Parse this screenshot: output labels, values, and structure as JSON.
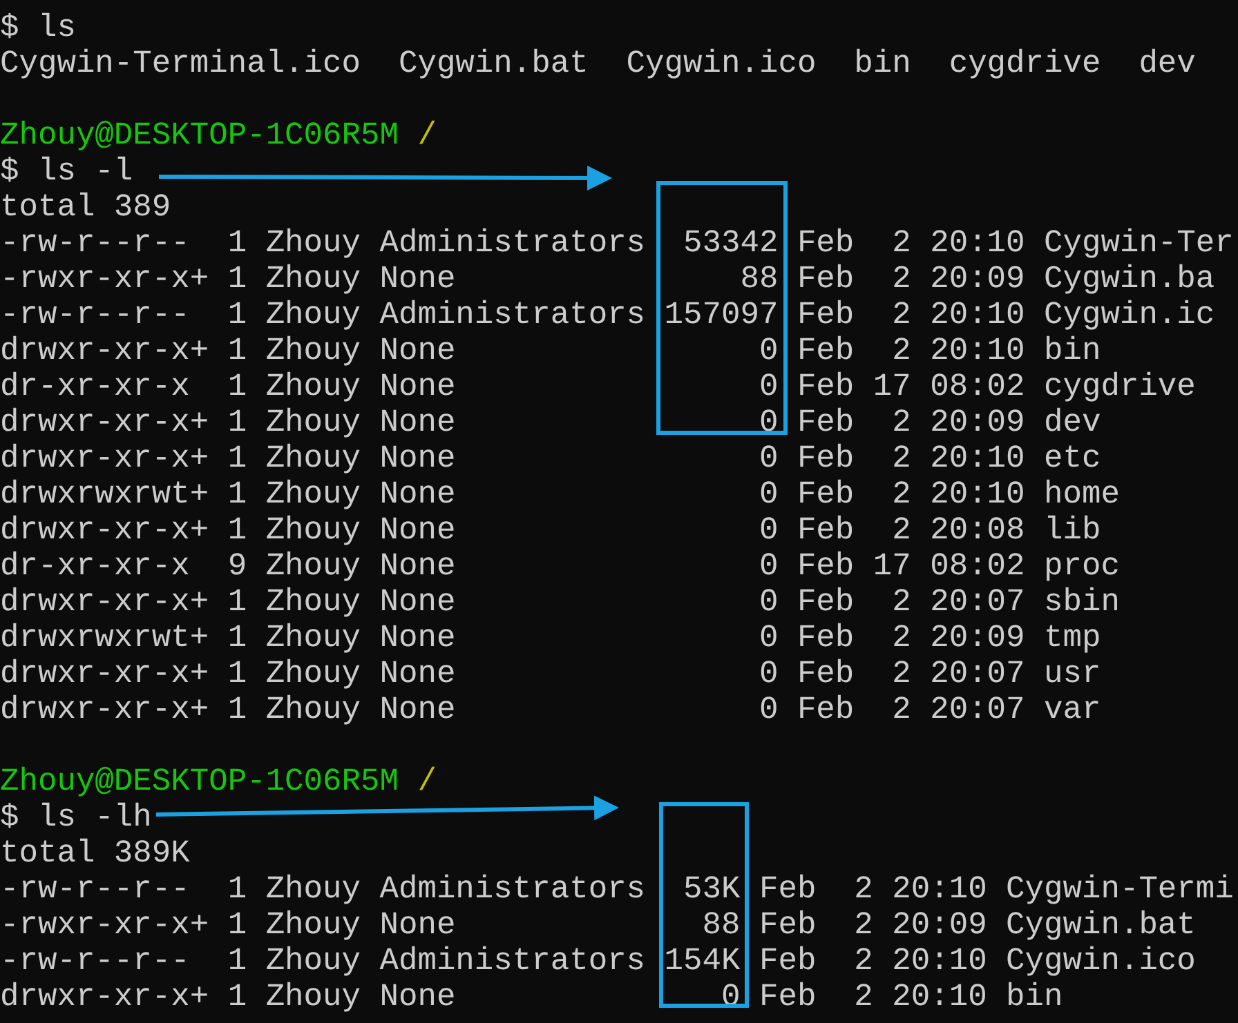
{
  "terminal": {
    "lines": [
      {
        "kind": "command",
        "text": "$ ls"
      },
      {
        "kind": "output",
        "text": "Cygwin-Terminal.ico  Cygwin.bat  Cygwin.ico  bin  cygdrive  dev"
      },
      {
        "kind": "blank"
      },
      {
        "kind": "prompt",
        "user_host": "Zhouy@DESKTOP-1C06R5M",
        "path": "/"
      },
      {
        "kind": "command",
        "text": "$ ls -l"
      },
      {
        "kind": "output",
        "text": "total 389"
      },
      {
        "kind": "output",
        "text": "-rw-r--r--  1 Zhouy Administrators  53342 Feb  2 20:10 Cygwin-Ter"
      },
      {
        "kind": "output",
        "text": "-rwxr-xr-x+ 1 Zhouy None               88 Feb  2 20:09 Cygwin.ba"
      },
      {
        "kind": "output",
        "text": "-rw-r--r--  1 Zhouy Administrators 157097 Feb  2 20:10 Cygwin.ic"
      },
      {
        "kind": "output",
        "text": "drwxr-xr-x+ 1 Zhouy None                0 Feb  2 20:10 bin"
      },
      {
        "kind": "output",
        "text": "dr-xr-xr-x  1 Zhouy None                0 Feb 17 08:02 cygdrive"
      },
      {
        "kind": "output",
        "text": "drwxr-xr-x+ 1 Zhouy None                0 Feb  2 20:09 dev"
      },
      {
        "kind": "output",
        "text": "drwxr-xr-x+ 1 Zhouy None                0 Feb  2 20:10 etc"
      },
      {
        "kind": "output",
        "text": "drwxrwxrwt+ 1 Zhouy None                0 Feb  2 20:10 home"
      },
      {
        "kind": "output",
        "text": "drwxr-xr-x+ 1 Zhouy None                0 Feb  2 20:08 lib"
      },
      {
        "kind": "output",
        "text": "dr-xr-xr-x  9 Zhouy None                0 Feb 17 08:02 proc"
      },
      {
        "kind": "output",
        "text": "drwxr-xr-x+ 1 Zhouy None                0 Feb  2 20:07 sbin"
      },
      {
        "kind": "output",
        "text": "drwxrwxrwt+ 1 Zhouy None                0 Feb  2 20:09 tmp"
      },
      {
        "kind": "output",
        "text": "drwxr-xr-x+ 1 Zhouy None                0 Feb  2 20:07 usr"
      },
      {
        "kind": "output",
        "text": "drwxr-xr-x+ 1 Zhouy None                0 Feb  2 20:07 var"
      },
      {
        "kind": "blank"
      },
      {
        "kind": "prompt",
        "user_host": "Zhouy@DESKTOP-1C06R5M",
        "path": "/"
      },
      {
        "kind": "command",
        "text": "$ ls -lh"
      },
      {
        "kind": "output",
        "text": "total 389K"
      },
      {
        "kind": "output",
        "text": "-rw-r--r--  1 Zhouy Administrators  53K Feb  2 20:10 Cygwin-Termi"
      },
      {
        "kind": "output",
        "text": "-rwxr-xr-x+ 1 Zhouy None             88 Feb  2 20:09 Cygwin.bat"
      },
      {
        "kind": "output",
        "text": "-rw-r--r--  1 Zhouy Administrators 154K Feb  2 20:10 Cygwin.ico"
      },
      {
        "kind": "output",
        "text": "drwxr-xr-x+ 1 Zhouy None              0 Feb  2 20:10 bin"
      }
    ]
  }
}
